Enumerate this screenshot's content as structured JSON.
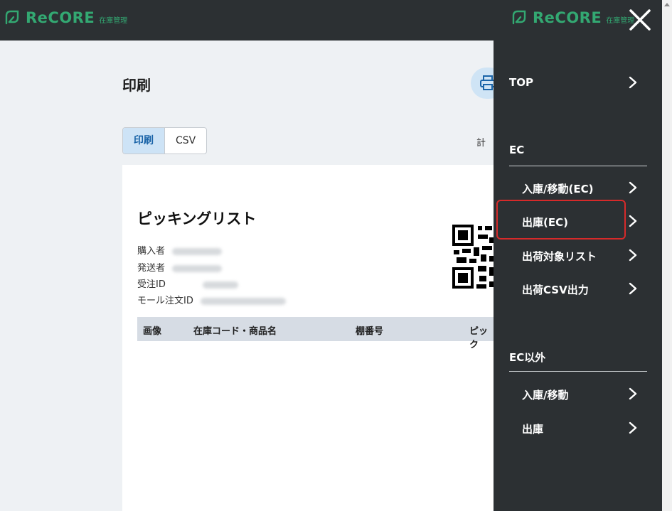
{
  "header": {
    "logo_word": "ReCORE",
    "logo_sub": "在庫管理"
  },
  "main": {
    "title": "印刷",
    "tabs": [
      {
        "label": "印刷",
        "active": true
      },
      {
        "label": "CSV",
        "active": false
      }
    ],
    "total_label": "計",
    "sheet": {
      "title": "ピッキングリスト",
      "fields": [
        {
          "label": "購入者"
        },
        {
          "label": "発送者"
        },
        {
          "label": "受注ID"
        },
        {
          "label": "モール注文ID"
        }
      ],
      "table_headers": [
        "画像",
        "在庫コード・商品名",
        "棚番号",
        "ピック"
      ]
    }
  },
  "menu": {
    "top_label": "TOP",
    "sections": [
      {
        "title": "EC",
        "items": [
          "入庫/移動(EC)",
          "出庫(EC)",
          "出荷対象リスト",
          "出荷CSV出力"
        ]
      },
      {
        "title": "EC以外",
        "items": [
          "入庫/移動",
          "出庫"
        ]
      }
    ],
    "highlighted_item": "出庫(EC)"
  },
  "colors": {
    "brand": "#33a872",
    "dark_bg": "#2c3033",
    "highlight": "#d62a2a",
    "tab_active": "#cde3f6"
  },
  "icons": [
    "recore-logo-icon",
    "close-icon",
    "printer-icon",
    "qr-code-icon",
    "chevron-right-icon"
  ]
}
